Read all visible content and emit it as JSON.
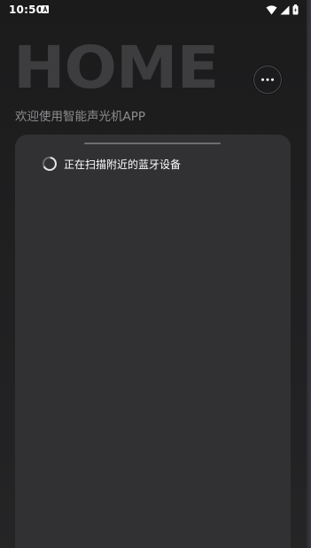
{
  "status_bar": {
    "time": "10:50",
    "icons": [
      "a-notification-icon",
      "wifi-icon",
      "signal-icon",
      "battery-icon"
    ]
  },
  "header": {
    "logo_text": "HOME",
    "subtitle": "欢迎使用智能声光机APP",
    "more_button_icon": "more-horizontal-icon"
  },
  "panel": {
    "scanning_text": "正在扫描附近的蓝牙设备"
  },
  "colors": {
    "background": "#1e1e1f",
    "panel": "#313134",
    "logo": "#3d3d3f",
    "subtitle": "#8d8d8f",
    "text": "#ffffff"
  }
}
